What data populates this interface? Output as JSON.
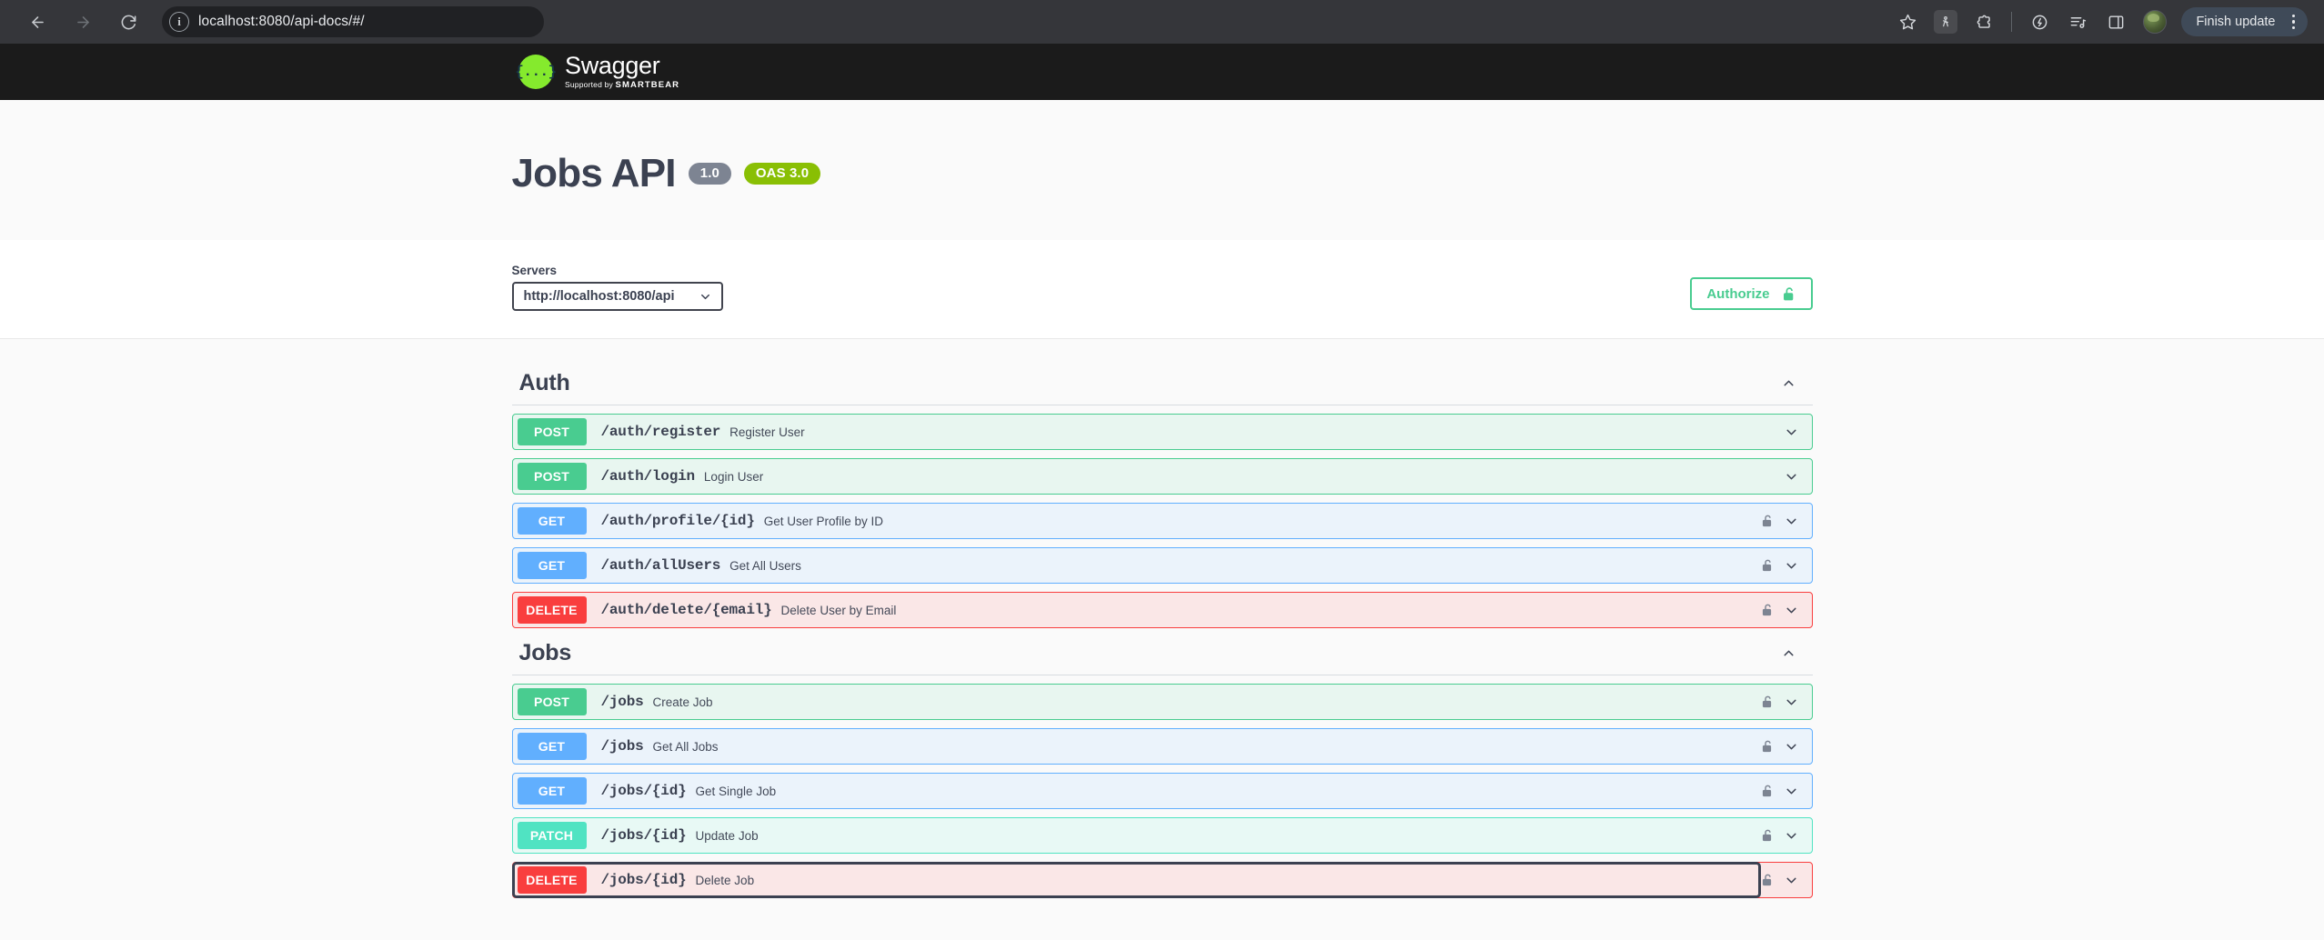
{
  "browser": {
    "url": "localhost:8080/api-docs/#/",
    "back_icon": "back-arrow-icon",
    "forward_icon": "forward-arrow-icon",
    "reload_icon": "reload-icon",
    "site_info_icon": "info-circle-icon",
    "bookmark_icon": "star-icon",
    "extension_icons": [
      "puzzle-piece-icon",
      "extension-icon"
    ],
    "split_icon": "split-screen-icon",
    "reading_list_icon": "reading-list-icon",
    "side_panel_icon": "side-panel-icon",
    "profile_icon": "avatar",
    "update_label": "Finish update",
    "menu_icon": "kebab-menu-icon"
  },
  "swagger_header": {
    "logo_glyph": "{...}",
    "brand": "Swagger",
    "tagline_prefix": "Supported by",
    "tagline_brand": "SMARTBEAR"
  },
  "info": {
    "title": "Jobs API",
    "version_badge": "1.0",
    "oas_badge": "OAS 3.0"
  },
  "servers": {
    "label": "Servers",
    "selected": "http://localhost:8080/api",
    "options": [
      "http://localhost:8080/api"
    ],
    "authorize_label": "Authorize",
    "authorize_icon": "unlock-icon"
  },
  "colors": {
    "post": "#49cc90",
    "get": "#61affe",
    "delete": "#f93e3e",
    "patch": "#50e3c2",
    "oas_badge": "#89bf04",
    "version_badge": "#7d8492",
    "text": "#3b4151",
    "topbar": "#1b1b1b"
  },
  "tags": [
    {
      "name": "Auth",
      "collapse_icon": "chevron-up-icon",
      "operations": [
        {
          "method": "POST",
          "path": "/auth/register",
          "summary": "Register User",
          "locked": false,
          "focused": false
        },
        {
          "method": "POST",
          "path": "/auth/login",
          "summary": "Login User",
          "locked": false,
          "focused": false
        },
        {
          "method": "GET",
          "path": "/auth/profile/{id}",
          "summary": "Get User Profile by ID",
          "locked": true,
          "focused": false
        },
        {
          "method": "GET",
          "path": "/auth/allUsers",
          "summary": "Get All Users",
          "locked": true,
          "focused": false
        },
        {
          "method": "DELETE",
          "path": "/auth/delete/{email}",
          "summary": "Delete User by Email",
          "locked": true,
          "focused": false
        }
      ]
    },
    {
      "name": "Jobs",
      "collapse_icon": "chevron-up-icon",
      "operations": [
        {
          "method": "POST",
          "path": "/jobs",
          "summary": "Create Job",
          "locked": true,
          "focused": false
        },
        {
          "method": "GET",
          "path": "/jobs",
          "summary": "Get All Jobs",
          "locked": true,
          "focused": false
        },
        {
          "method": "GET",
          "path": "/jobs/{id}",
          "summary": "Get Single Job",
          "locked": true,
          "focused": false
        },
        {
          "method": "PATCH",
          "path": "/jobs/{id}",
          "summary": "Update Job",
          "locked": true,
          "focused": false
        },
        {
          "method": "DELETE",
          "path": "/jobs/{id}",
          "summary": "Delete Job",
          "locked": true,
          "focused": true
        }
      ]
    }
  ]
}
